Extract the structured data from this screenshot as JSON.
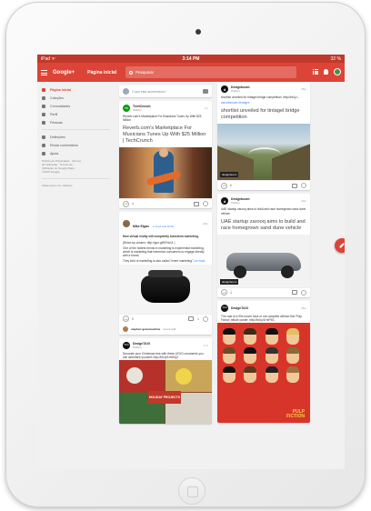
{
  "status": {
    "left": "iPad ᯤ",
    "time": "3:14 PM",
    "right": "32 %"
  },
  "appbar": {
    "logo": "Google+",
    "page_title": "Página inicial",
    "search_placeholder": "Pesquisar"
  },
  "sidebar": {
    "items": [
      {
        "label": "Página inicial",
        "icon": "home-icon",
        "active": true
      },
      {
        "label": "Coleções",
        "icon": "collections-icon"
      },
      {
        "label": "Comunidades",
        "icon": "communities-icon"
      },
      {
        "label": "Perfil",
        "icon": "profile-icon"
      },
      {
        "label": "Pessoas",
        "icon": "people-icon"
      },
      {
        "label": "Definições",
        "icon": "settings-icon"
      },
      {
        "label": "Enviar comentários",
        "icon": "feedback-icon"
      },
      {
        "label": "Ajuda",
        "icon": "help-icon"
      }
    ],
    "footer_lines": [
      "Política de Privacidade · Termos",
      "de Utilização · Termos de",
      "Utilização do Google Maps",
      "©2015 Google"
    ],
    "bottom_link": "Voltar para o G+ clássico"
  },
  "share_box": {
    "placeholder": "O que está acontecendo?"
  },
  "posts_left": [
    {
      "author": "TechCrunch",
      "visibility": "Público",
      "time": "1 h",
      "intro": "Reverb.com's Marketplace For Musicians Tunes Up With $25 Million",
      "headline": "Reverb.com's Marketplace For Musicians Tunes Up With $25 Million | TechCrunch",
      "plus": "+1",
      "count": "4"
    },
    {
      "author": "Mike Elgan",
      "via": "Food and Drink",
      "time": "20m",
      "line1": "How virtual reality will completely transform marketing.",
      "line2": "(Read my column: http://goo.gl/KRrLK4 )",
      "line3": "One of the hottest trends in marketing is experiential marketing, which is marketing that immerses consumers to engage directly with a brand.",
      "line4": "They kind of marketing is also called \"event marketing\"",
      "more": "Ler mais",
      "plus": "+1",
      "count": "5",
      "comments": "1",
      "commenter": "stephen getsomeslims",
      "comment": "Good stuff"
    },
    {
      "author": "DesignTAXI",
      "visibility": "Público",
      "time": "1 hr",
      "intro": "Decorate your Christmas tree with these LEGO ornaments you can assemble yourself: http://bit.ly/1HtISQ2",
      "image_text": "HOLIDAY PROJECTS"
    }
  ],
  "posts_right": [
    {
      "author": "Designboom",
      "visibility": "Público",
      "time": "25m",
      "intro": "shortlist unveiled for tintagel bridge competition: http://bit.ly/...",
      "tags": "#architecture #bridges",
      "headline": "shortlist unveiled for tintagel bridge competition",
      "image_tag": "designboom",
      "plus": "+1",
      "count": "6"
    },
    {
      "author": "Designboom",
      "visibility": "Público",
      "time": "44m",
      "intro": "UAE startup zarooq aims to build and race homegrown sand dune vehicle",
      "headline": "UAE startup zarooq aims to build and race homegrown sand dune vehicle",
      "image_tag": "designboom",
      "plus": "+1",
      "count": "4"
    },
    {
      "author": "DesignTAXI",
      "visibility": "Público",
      "time": "45m",
      "intro": "The cast of a 90s movie 'face or not complete without this 'Pulp Fiction' tribute poster: http://bit.ly/1HxF9I1",
      "poster_title": "PULP FICTION"
    }
  ]
}
